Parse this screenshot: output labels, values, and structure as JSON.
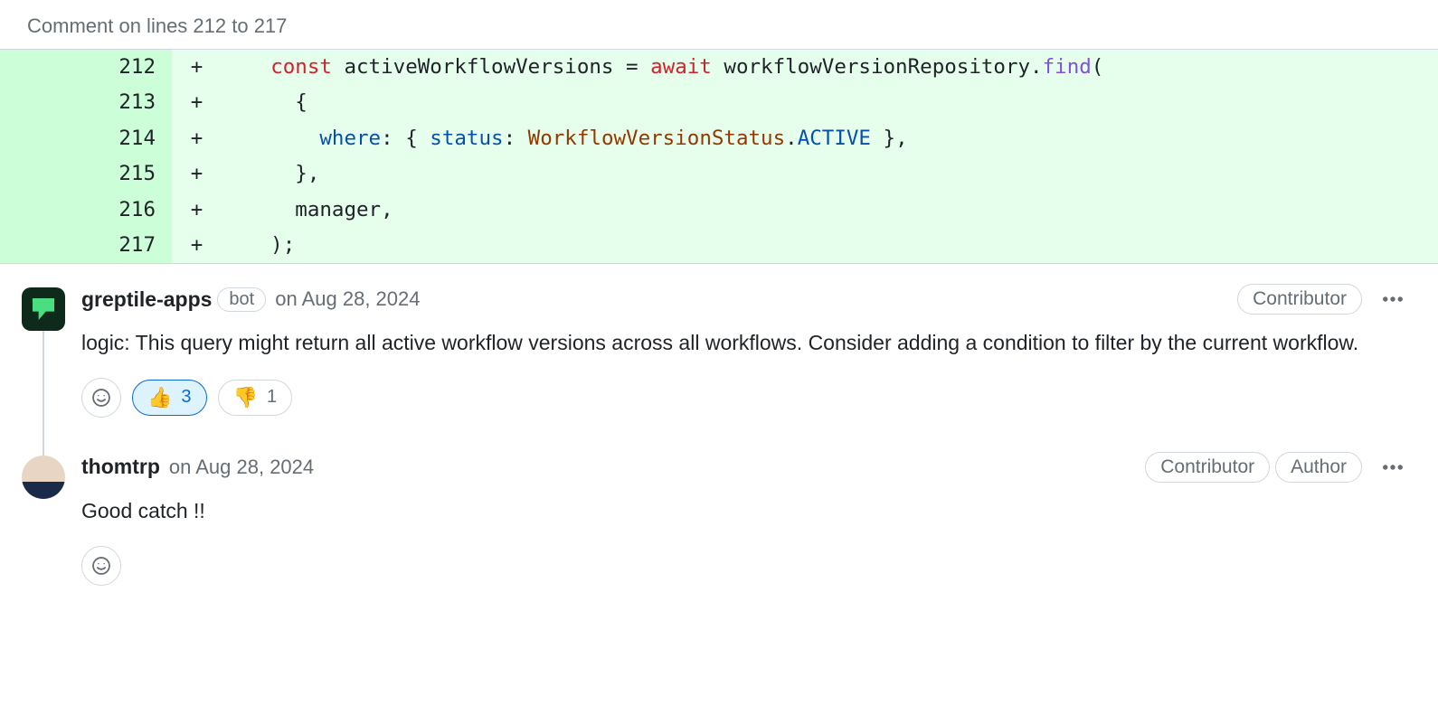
{
  "header": {
    "line_range_text": "Comment on lines 212 to 217"
  },
  "code": {
    "lines": [
      {
        "num": "212",
        "marker": "+",
        "segments": [
          {
            "t": "    ",
            "c": ""
          },
          {
            "t": "const",
            "c": "kw-const"
          },
          {
            "t": " activeWorkflowVersions = ",
            "c": ""
          },
          {
            "t": "await",
            "c": "kw-await"
          },
          {
            "t": " workflowVersionRepository.",
            "c": ""
          },
          {
            "t": "find",
            "c": "fn-call"
          },
          {
            "t": "(",
            "c": ""
          }
        ]
      },
      {
        "num": "213",
        "marker": "+",
        "segments": [
          {
            "t": "      {",
            "c": ""
          }
        ]
      },
      {
        "num": "214",
        "marker": "+",
        "segments": [
          {
            "t": "        ",
            "c": ""
          },
          {
            "t": "where",
            "c": "prop"
          },
          {
            "t": ": { ",
            "c": ""
          },
          {
            "t": "status",
            "c": "prop"
          },
          {
            "t": ": ",
            "c": ""
          },
          {
            "t": "WorkflowVersionStatus",
            "c": "class-name"
          },
          {
            "t": ".",
            "c": ""
          },
          {
            "t": "ACTIVE",
            "c": "enum-val"
          },
          {
            "t": " },",
            "c": ""
          }
        ]
      },
      {
        "num": "215",
        "marker": "+",
        "segments": [
          {
            "t": "      },",
            "c": ""
          }
        ]
      },
      {
        "num": "216",
        "marker": "+",
        "segments": [
          {
            "t": "      manager,",
            "c": ""
          }
        ]
      },
      {
        "num": "217",
        "marker": "+",
        "segments": [
          {
            "t": "    );",
            "c": ""
          }
        ]
      }
    ]
  },
  "comments": [
    {
      "author": "greptile-apps",
      "is_bot": true,
      "bot_label": "bot",
      "timestamp": "on Aug 28, 2024",
      "roles": [
        "Contributor"
      ],
      "body": "logic: This query might return all active workflow versions across all workflows. Consider adding a condition to filter by the current workflow.",
      "reactions": [
        {
          "emoji": "👍",
          "count": "3",
          "active": true
        },
        {
          "emoji": "👎",
          "count": "1",
          "active": false
        }
      ]
    },
    {
      "author": "thomtrp",
      "is_bot": false,
      "timestamp": "on Aug 28, 2024",
      "roles": [
        "Contributor",
        "Author"
      ],
      "body": "Good catch !!",
      "reactions": []
    }
  ]
}
